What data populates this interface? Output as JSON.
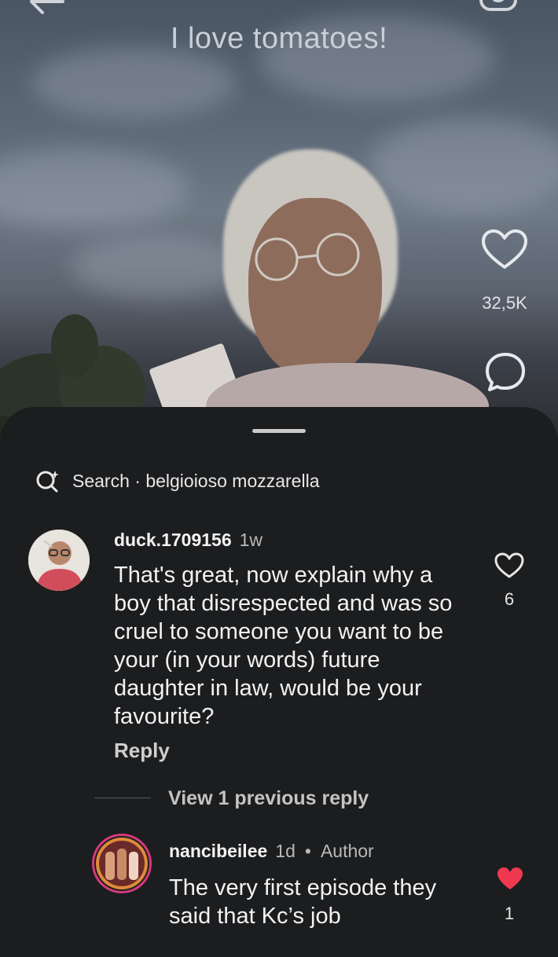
{
  "video": {
    "title": "I love tomatoes!",
    "like_count": "32,5K",
    "icons": [
      "back-arrow-icon",
      "camera-icon",
      "heart-icon",
      "comment-icon"
    ]
  },
  "sheet": {
    "search_label": "Search · belgioioso mozzarella",
    "comments": [
      {
        "username": "duck.1709156",
        "time": "1w",
        "text": "That's great, now explain why a boy that disrespected and was so cruel to someone you want to be your (in your words) future daughter in law, would be your favourite?",
        "like_count": "6",
        "liked": false,
        "reply_label": "Reply"
      }
    ],
    "view_replies_label": "View 1 previous reply",
    "reply": {
      "username": "nancibeilee",
      "time": "1d",
      "separator": "•",
      "badge": "Author",
      "text": "The very first episode they said that Kc’s job",
      "like_count": "1",
      "liked": true
    }
  },
  "colors": {
    "sheet_bg": "#1c1d1f",
    "liked_heart": "#f0394f",
    "avatar_ring": "#d43a7c"
  }
}
